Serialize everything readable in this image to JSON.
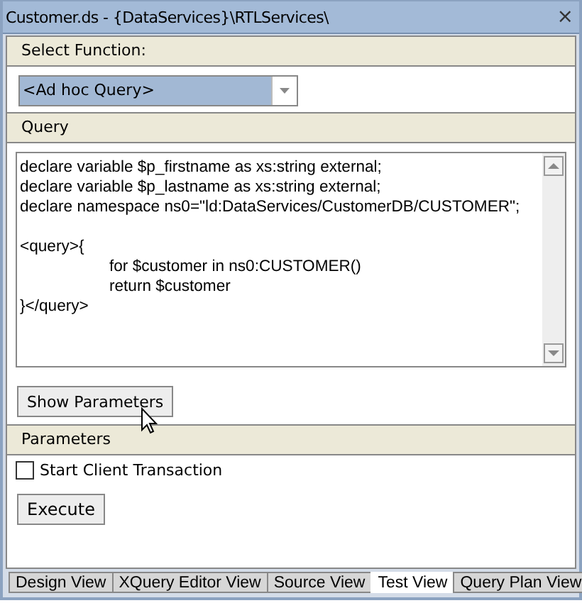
{
  "window": {
    "title": "Customer.ds - {DataServices}\\RTLServices\\",
    "close": "×"
  },
  "function_section": {
    "header": "Select Function:",
    "dropdown": {
      "value": "<Ad hoc Query>"
    }
  },
  "query_section": {
    "header": "Query",
    "text": "declare variable $p_firstname as xs:string external;\ndeclare variable $p_lastname as xs:string external;\ndeclare namespace ns0=\"ld:DataServices/CustomerDB/CUSTOMER\";\n\n<query>{\n\tfor $customer in ns0:CUSTOMER()\n\treturn $customer\n}</query>",
    "button": "Show Parameters"
  },
  "parameters_section": {
    "header": "Parameters",
    "checkbox": {
      "label": "Start Client Transaction",
      "checked": false
    },
    "button": "Execute"
  },
  "tabs": [
    {
      "label": "Design View",
      "selected": false
    },
    {
      "label": "XQuery Editor View",
      "selected": false
    },
    {
      "label": "Source View",
      "selected": false
    },
    {
      "label": "Test View",
      "selected": true
    },
    {
      "label": "Query Plan View",
      "selected": false
    }
  ]
}
